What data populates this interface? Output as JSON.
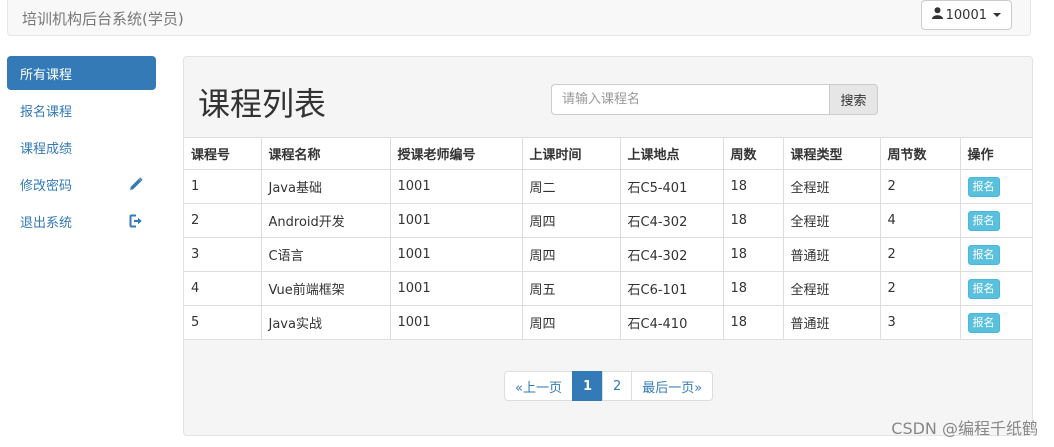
{
  "header": {
    "brand": "培训机构后台系统(学员)",
    "user_label": "10001"
  },
  "sidebar": {
    "items": [
      {
        "label": "所有课程",
        "active": true,
        "icon": ""
      },
      {
        "label": "报名课程",
        "active": false,
        "icon": ""
      },
      {
        "label": "课程成绩",
        "active": false,
        "icon": ""
      },
      {
        "label": "修改密码",
        "active": false,
        "icon": "pencil-icon"
      },
      {
        "label": "退出系统",
        "active": false,
        "icon": "logout-icon"
      }
    ]
  },
  "main": {
    "title": "课程列表",
    "search": {
      "placeholder": "请输入课程名",
      "button_label": "搜索"
    },
    "table": {
      "headers": [
        "课程号",
        "课程名称",
        "授课老师编号",
        "上课时间",
        "上课地点",
        "周数",
        "课程类型",
        "周节数",
        "操作"
      ],
      "rows": [
        [
          "1",
          "Java基础",
          "1001",
          "周二",
          "石C5-401",
          "18",
          "全程班",
          "2",
          "报名"
        ],
        [
          "2",
          "Android开发",
          "1001",
          "周四",
          "石C4-302",
          "18",
          "全程班",
          "4",
          "报名"
        ],
        [
          "3",
          "C语言",
          "1001",
          "周四",
          "石C4-302",
          "18",
          "普通班",
          "2",
          "报名"
        ],
        [
          "4",
          "Vue前端框架",
          "1001",
          "周五",
          "石C6-101",
          "18",
          "全程班",
          "2",
          "报名"
        ],
        [
          "5",
          "Java实战",
          "1001",
          "周四",
          "石C4-410",
          "18",
          "普通班",
          "3",
          "报名"
        ]
      ]
    },
    "pagination": {
      "prev": "«上一页",
      "pages": [
        "1",
        "2"
      ],
      "current": "1",
      "last": "最后一页»"
    }
  },
  "watermark": "CSDN @编程千纸鹤",
  "colors": {
    "primary": "#337ab7",
    "info": "#5bc0de"
  }
}
